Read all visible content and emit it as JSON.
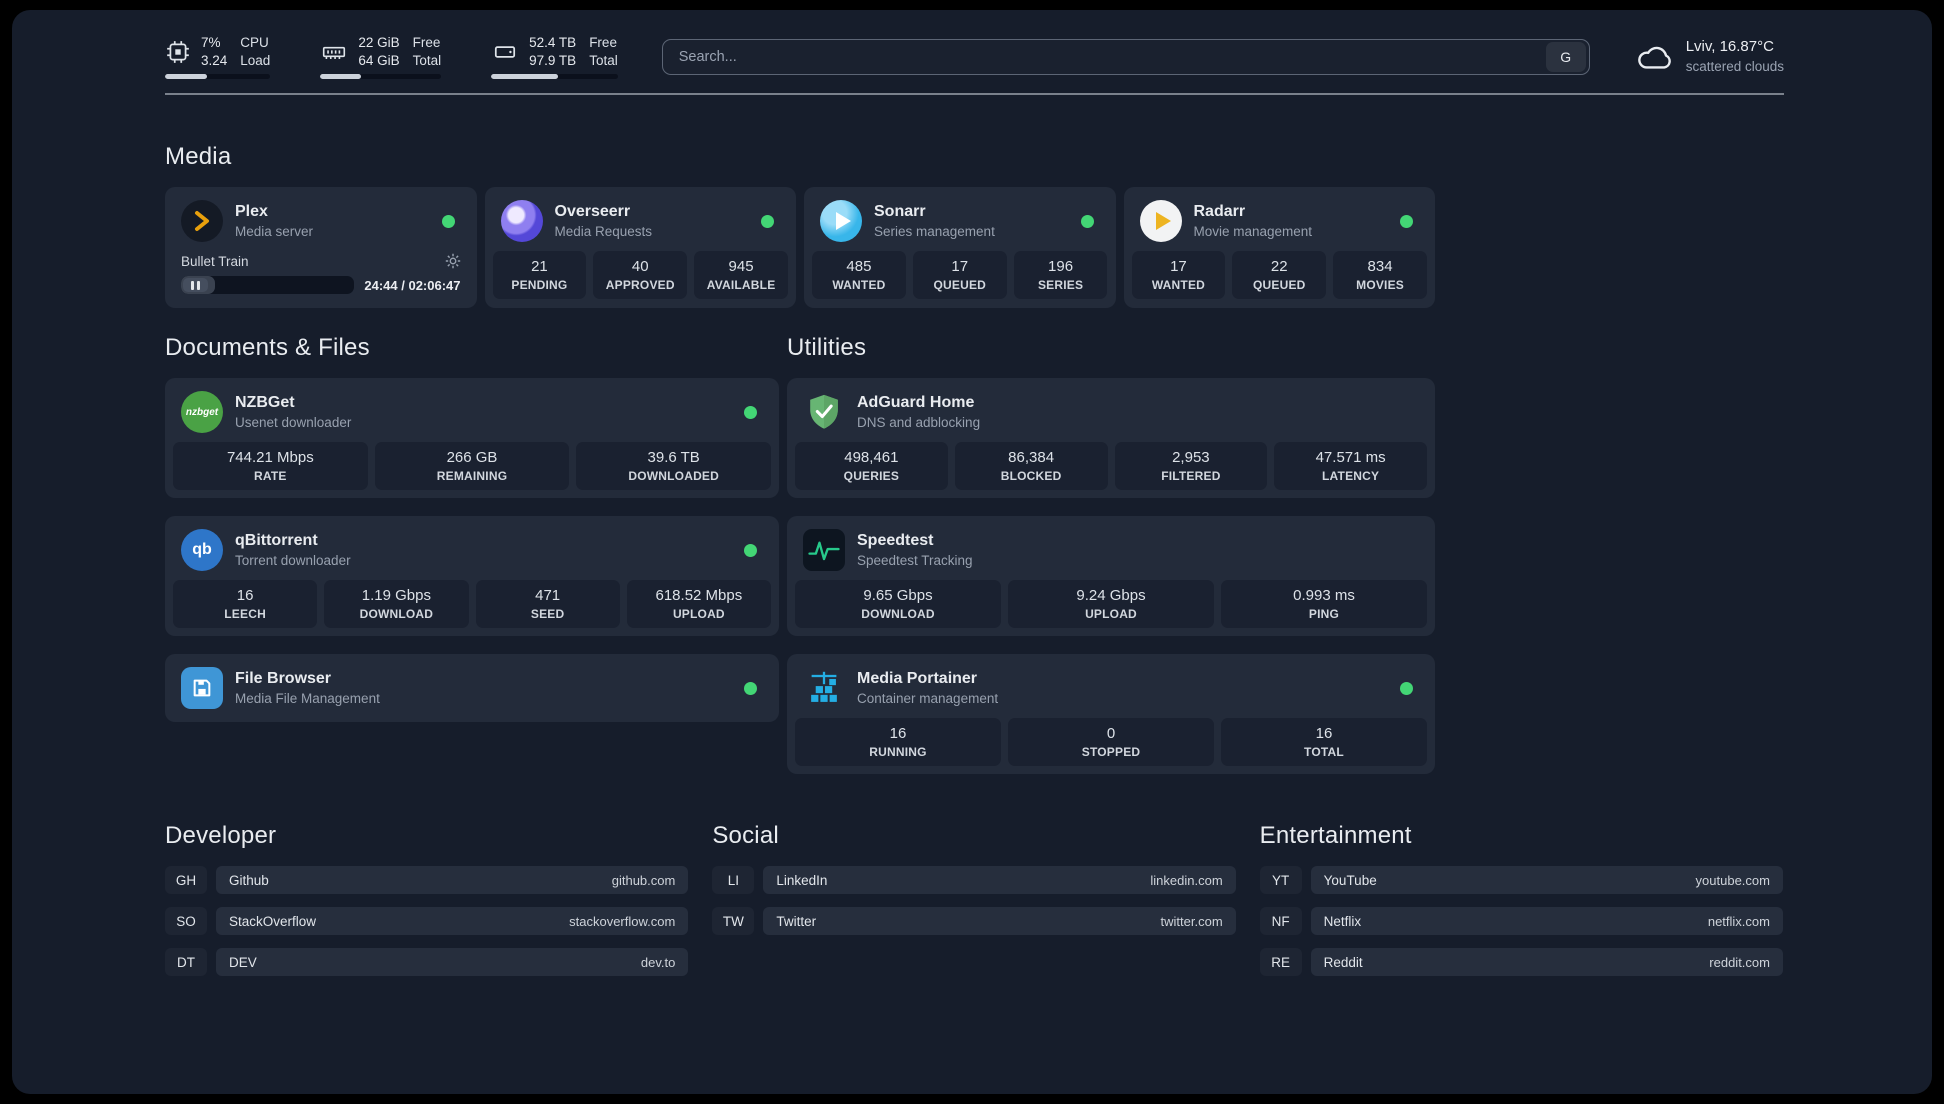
{
  "colors": {
    "background": "#161d2b",
    "card": "#232b3a",
    "status_online": "#43d675",
    "plex_accent": "#e8a00c"
  },
  "header": {
    "resources": [
      {
        "name": "cpu",
        "icon": "cpu-icon",
        "values": [
          "7%",
          "3.24"
        ],
        "labels": [
          "CPU",
          "Load"
        ],
        "progress_pct": 40
      },
      {
        "name": "memory",
        "icon": "memory-icon",
        "values": [
          "22 GiB",
          "64 GiB"
        ],
        "labels": [
          "Free",
          "Total"
        ],
        "progress_pct": 34
      },
      {
        "name": "disk",
        "icon": "disk-icon",
        "values": [
          "52.4 TB",
          "97.9 TB"
        ],
        "labels": [
          "Free",
          "Total"
        ],
        "progress_pct": 53
      }
    ],
    "search": {
      "placeholder": "Search...",
      "provider_label": "G"
    },
    "weather": {
      "icon": "cloud-icon",
      "location": "Lviv, 16.87°C",
      "condition": "scattered clouds"
    }
  },
  "sections": {
    "media": {
      "title": "Media",
      "services": [
        {
          "name": "Plex",
          "subtitle": "Media server",
          "icon": "plex-icon",
          "status": "online",
          "player": {
            "track": "Bullet Train",
            "time": "24:44 / 02:06:47",
            "progress_pct": 19.5
          }
        },
        {
          "name": "Overseerr",
          "subtitle": "Media Requests",
          "icon": "overseerr-icon",
          "status": "online",
          "stats": [
            {
              "value": "21",
              "label": "PENDING"
            },
            {
              "value": "40",
              "label": "APPROVED"
            },
            {
              "value": "945",
              "label": "AVAILABLE"
            }
          ]
        },
        {
          "name": "Sonarr",
          "subtitle": "Series management",
          "icon": "sonarr-icon",
          "status": "online",
          "stats": [
            {
              "value": "485",
              "label": "WANTED"
            },
            {
              "value": "17",
              "label": "QUEUED"
            },
            {
              "value": "196",
              "label": "SERIES"
            }
          ]
        },
        {
          "name": "Radarr",
          "subtitle": "Movie management",
          "icon": "radarr-icon",
          "status": "online",
          "stats": [
            {
              "value": "17",
              "label": "WANTED"
            },
            {
              "value": "22",
              "label": "QUEUED"
            },
            {
              "value": "834",
              "label": "MOVIES"
            }
          ]
        }
      ]
    },
    "files": {
      "title": "Documents & Files",
      "services": [
        {
          "name": "NZBGet",
          "subtitle": "Usenet downloader",
          "icon": "nzbget-icon",
          "icon_label": "nzbget",
          "status": "online",
          "stats": [
            {
              "value": "744.21 Mbps",
              "label": "RATE"
            },
            {
              "value": "266 GB",
              "label": "REMAINING"
            },
            {
              "value": "39.6 TB",
              "label": "DOWNLOADED"
            }
          ]
        },
        {
          "name": "qBittorrent",
          "subtitle": "Torrent downloader",
          "icon": "qbittorrent-icon",
          "icon_label": "qb",
          "status": "online",
          "stats": [
            {
              "value": "16",
              "label": "LEECH"
            },
            {
              "value": "1.19 Gbps",
              "label": "DOWNLOAD"
            },
            {
              "value": "471",
              "label": "SEED"
            },
            {
              "value": "618.52 Mbps",
              "label": "UPLOAD"
            }
          ]
        },
        {
          "name": "File Browser",
          "subtitle": "Media File Management",
          "icon": "filebrowser-icon",
          "status": "online",
          "stats": []
        }
      ]
    },
    "utilities": {
      "title": "Utilities",
      "services": [
        {
          "name": "AdGuard Home",
          "subtitle": "DNS and adblocking",
          "icon": "adguard-icon",
          "stats": [
            {
              "value": "498,461",
              "label": "QUERIES"
            },
            {
              "value": "86,384",
              "label": "BLOCKED"
            },
            {
              "value": "2,953",
              "label": "FILTERED"
            },
            {
              "value": "47.571 ms",
              "label": "LATENCY"
            }
          ]
        },
        {
          "name": "Speedtest",
          "subtitle": "Speedtest Tracking",
          "icon": "speedtest-icon",
          "stats": [
            {
              "value": "9.65 Gbps",
              "label": "DOWNLOAD"
            },
            {
              "value": "9.24 Gbps",
              "label": "UPLOAD"
            },
            {
              "value": "0.993 ms",
              "label": "PING"
            }
          ]
        },
        {
          "name": "Media Portainer",
          "subtitle": "Container management",
          "icon": "portainer-icon",
          "status": "online",
          "stats": [
            {
              "value": "16",
              "label": "RUNNING"
            },
            {
              "value": "0",
              "label": "STOPPED"
            },
            {
              "value": "16",
              "label": "TOTAL"
            }
          ]
        }
      ]
    }
  },
  "bookmarks": {
    "groups": [
      {
        "title": "Developer",
        "items": [
          {
            "abbr": "GH",
            "name": "Github",
            "url": "github.com"
          },
          {
            "abbr": "SO",
            "name": "StackOverflow",
            "url": "stackoverflow.com"
          },
          {
            "abbr": "DT",
            "name": "DEV",
            "url": "dev.to"
          }
        ]
      },
      {
        "title": "Social",
        "items": [
          {
            "abbr": "LI",
            "name": "LinkedIn",
            "url": "linkedin.com"
          },
          {
            "abbr": "TW",
            "name": "Twitter",
            "url": "twitter.com"
          }
        ]
      },
      {
        "title": "Entertainment",
        "items": [
          {
            "abbr": "YT",
            "name": "YouTube",
            "url": "youtube.com"
          },
          {
            "abbr": "NF",
            "name": "Netflix",
            "url": "netflix.com"
          },
          {
            "abbr": "RE",
            "name": "Reddit",
            "url": "reddit.com"
          }
        ]
      }
    ]
  }
}
